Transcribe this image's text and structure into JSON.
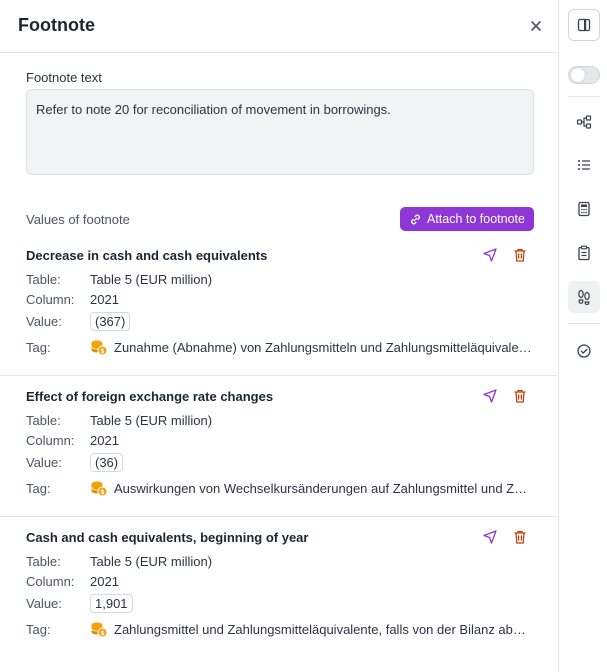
{
  "panel": {
    "title": "Footnote",
    "footnote_label": "Footnote text",
    "footnote_text": "Refer to note 20 for reconciliation of movement in borrowings.",
    "values_label": "Values of footnote",
    "attach_label": "Attach to footnote"
  },
  "labels": {
    "table": "Table:",
    "column": "Column:",
    "value": "Value:",
    "tag": "Tag:"
  },
  "items": [
    {
      "name": "Decrease in cash and cash equivalents",
      "table": "Table 5 (EUR million)",
      "column": "2021",
      "value": "(367)",
      "tag": "Zunahme (Abnahme) von Zahlungsmitteln und Zahlungsmitteläquivalenten"
    },
    {
      "name": "Effect of foreign exchange rate changes",
      "table": "Table 5 (EUR million)",
      "column": "2021",
      "value": "(36)",
      "tag": "Auswirkungen von Wechselkursänderungen auf Zahlungsmittel und Zahlungsmitteläquivalente"
    },
    {
      "name": "Cash and cash equivalents, beginning of year",
      "table": "Table 5 (EUR million)",
      "column": "2021",
      "value": "1,901",
      "tag": "Zahlungsmittel und Zahlungsmitteläquivalente, falls von der Bilanz abweichend"
    }
  ],
  "icons": {
    "close": "close-icon",
    "attach": "link-icon",
    "navigate": "cursor-arrow-icon",
    "delete": "trash-icon",
    "tag": "coins-icon",
    "rail": [
      "panel-layout-icon",
      "toggle-switch",
      "hierarchy-icon",
      "list-icon",
      "calculator-icon",
      "clipboard-icon",
      "footprints-icon",
      "check-circle-icon"
    ]
  },
  "colors": {
    "accent": "#8e36d6",
    "delete": "#c2410c",
    "coin": "#f0a30a"
  }
}
